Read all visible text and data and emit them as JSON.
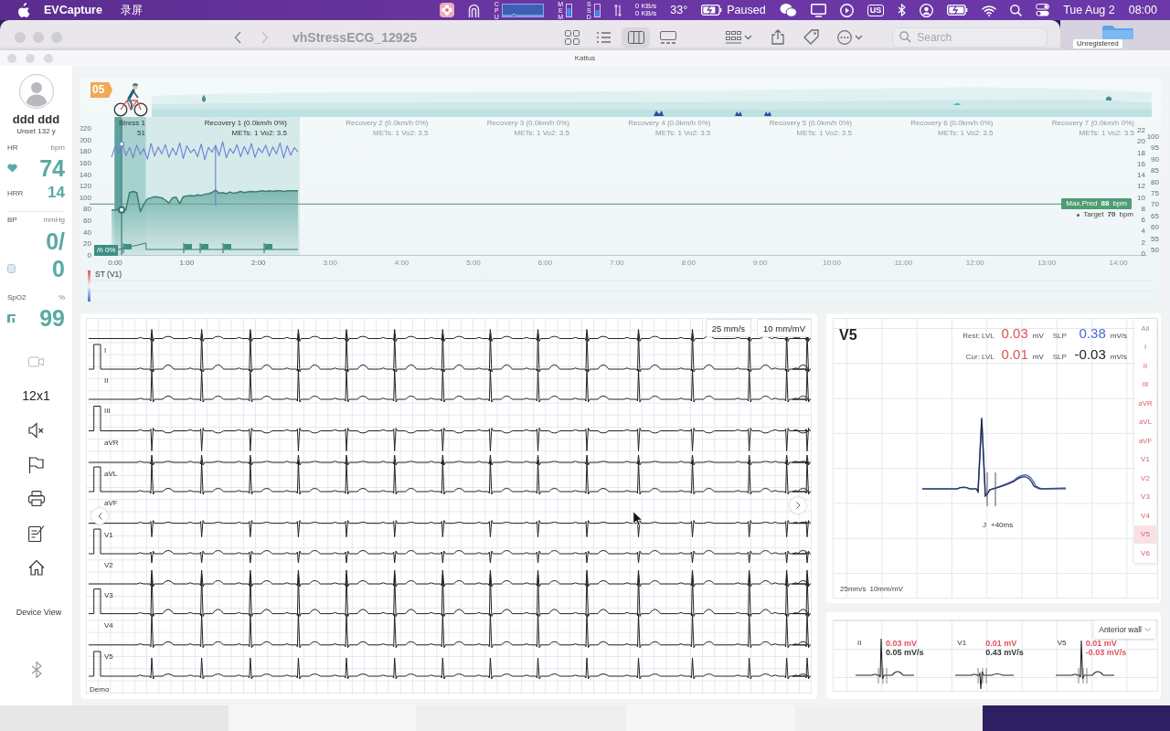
{
  "menu_bar": {
    "app_name": "EVCapture",
    "menus": [
      "录屏"
    ],
    "cpu_label": "CPU",
    "mem_label": "MEM",
    "ssd_label": "SSD",
    "upload": "0 KB/s",
    "download": "0 KB/s",
    "temperature": "33°",
    "battery_status": "Paused",
    "input_source": "US",
    "date": "Tue Aug 2",
    "time": "08:00"
  },
  "finder": {
    "title": "vhStressECG_12925",
    "view_modes": [
      {
        "kind": "icons",
        "selected": false
      },
      {
        "kind": "list",
        "selected": false
      },
      {
        "kind": "columns",
        "selected": true
      },
      {
        "kind": "gallery",
        "selected": false
      }
    ],
    "search": {
      "placeholder": "Search"
    },
    "badge": "Unregistered"
  },
  "window": {
    "title": "Kattus"
  },
  "sidebar": {
    "patient": {
      "name": "ddd ddd",
      "info": "Unset 132 y"
    },
    "vitals": [
      {
        "kind": "hr",
        "label": "HR",
        "unit": "bpm",
        "value": "74"
      },
      {
        "kind": "hrr",
        "label": "HRR",
        "value": "14"
      },
      {
        "kind": "bp",
        "label": "BP",
        "unit": "mmHg",
        "value": "0/",
        "value2": "0"
      },
      {
        "kind": "spo2",
        "label": "SpO2",
        "unit": "%",
        "value": "99"
      }
    ],
    "layout_label": "12x1",
    "device_view": "Device View"
  },
  "trend": {
    "stage_badge": "05",
    "stages": [
      {
        "name": "Stress 1",
        "detail": "51",
        "recorded": true
      },
      {
        "name": "Recovery 1 (0.0km/h 0%)",
        "detail": "METs: 1 Vo2: 3.5",
        "recorded": true
      },
      {
        "name": "Recovery 2 (0.0km/h 0%)",
        "detail": "METs: 1 Vo2: 3.5",
        "recorded": false
      },
      {
        "name": "Recovery 3 (0.0km/h 0%)",
        "detail": "METs: 1 Vo2: 3.5",
        "recorded": false
      },
      {
        "name": "Recovery 4 (0.0km/h 0%)",
        "detail": "METs: 1 Vo2: 3.5",
        "recorded": false
      },
      {
        "name": "Recovery 5 (0.0km/h 0%)",
        "detail": "METs: 1 Vo2: 3.5",
        "recorded": false
      },
      {
        "name": "Recovery 6 (0.0km/h 0%)",
        "detail": "METs: 1 Vo2: 3.5",
        "recorded": false
      },
      {
        "name": "Recovery 7 (0.0km/h 0%)",
        "detail": "METs: 1 Vo2: 3.5",
        "recorded": false
      }
    ],
    "speed_badge": "/h 0%",
    "chart_data": {
      "type": "line",
      "x": [
        -0.05,
        0,
        0.05,
        0.1,
        0.15,
        0.2,
        0.25,
        0.3,
        0.35,
        0.4,
        0.45,
        0.5,
        0.55,
        0.6,
        0.65,
        0.7,
        0.75,
        0.8,
        0.85,
        0.9,
        0.95,
        1,
        1.05,
        1.1,
        1.15,
        1.2,
        1.25,
        1.3,
        1.35,
        1.4,
        1.45,
        1.5,
        1.55,
        1.6,
        1.65,
        1.7,
        1.75,
        1.8,
        1.85,
        1.9,
        1.95,
        2,
        2.05,
        2.1,
        2.15,
        2.2,
        2.25,
        2.3,
        2.35,
        2.4,
        2.45,
        2.5,
        2.55
      ],
      "series": [
        {
          "color": "#6c7fd6",
          "values": [
            170,
            188,
            176,
            192,
            172,
            186,
            168,
            190,
            174,
            184,
            166,
            193,
            171,
            187,
            175,
            191,
            169,
            185,
            173,
            194,
            167,
            189,
            177,
            183,
            170,
            192,
            165,
            186,
            178,
            190,
            172,
            196,
            168,
            184,
            176,
            191,
            170,
            188,
            174,
            193,
            169,
            185,
            177,
            190,
            171,
            187,
            175,
            194,
            168,
            189,
            173,
            186,
            178
          ]
        },
        {
          "color": "#3f7c74",
          "values": [
            78,
            78,
            78,
            78,
            78,
            108,
            110,
            108,
            75,
            88,
            97,
            99,
            101,
            100,
            99,
            95,
            90,
            99,
            100,
            89,
            101,
            102,
            103,
            102,
            104,
            103,
            105,
            106,
            108,
            112,
            107,
            108,
            106,
            109,
            107,
            108,
            110,
            108,
            109,
            110,
            109,
            110,
            111,
            110,
            111,
            110,
            111,
            111,
            110,
            111,
            111,
            111,
            111
          ]
        }
      ],
      "xlim": [
        -0.1,
        14.4
      ],
      "ylim": [
        0,
        220
      ],
      "yticks": [
        0,
        20,
        40,
        60,
        80,
        100,
        120,
        140,
        160,
        180,
        200,
        220
      ],
      "xticks": [
        {
          "value": 0,
          "label": "0:00"
        },
        {
          "value": 1,
          "label": "1:00"
        },
        {
          "value": 2,
          "label": "2:00"
        },
        {
          "value": 3,
          "label": "3:00"
        },
        {
          "value": 4,
          "label": "4:00"
        },
        {
          "value": 5,
          "label": "5:00"
        },
        {
          "value": 6,
          "label": "6:00"
        },
        {
          "value": 7,
          "label": "7:00"
        },
        {
          "value": 8,
          "label": "8:00"
        },
        {
          "value": 9,
          "label": "9:00"
        },
        {
          "value": 10,
          "label": "10:00"
        },
        {
          "value": 11,
          "label": "11:00"
        },
        {
          "value": 12,
          "label": "12:00"
        },
        {
          "value": 13,
          "label": "13:00"
        },
        {
          "value": 14,
          "label": "14:00"
        }
      ]
    },
    "right_axis": {
      "outer": [
        "100",
        "95",
        "90",
        "85",
        "80",
        "75",
        "70",
        "65",
        "60",
        "55",
        "50"
      ],
      "inner": [
        "22",
        "20",
        "18",
        "16",
        "14",
        "12",
        "10",
        "8",
        "6",
        "4",
        "2",
        "0"
      ]
    },
    "max_pred": {
      "label": "Max.Pred",
      "value": "88",
      "unit": "bpm"
    },
    "target": {
      "label": "Target",
      "value": "70",
      "unit": "bpm"
    },
    "st_label": "ST (V1)"
  },
  "ecg_strip": {
    "leads": [
      "I",
      "II",
      "III",
      "aVR",
      "aVL",
      "aVF",
      "V1",
      "V2",
      "V3",
      "V4",
      "V5"
    ],
    "footer": "Demo",
    "speed": "25 mm/s",
    "gain": "10 mm/mV"
  },
  "st_detail": {
    "lead": "V5",
    "rows": [
      {
        "label": "Rest: LVL",
        "lvl": {
          "value": "0.03",
          "unit": "mV",
          "color": "#e0505a"
        },
        "slp": {
          "label": "SLP",
          "value": "0.38",
          "unit": "mV/s",
          "color": "#4a6bd0"
        }
      },
      {
        "label": "Cur: LVL",
        "lvl": {
          "value": "0.01",
          "unit": "mV",
          "color": "#e0505a"
        },
        "slp": {
          "label": "SLP",
          "value": "-0.03",
          "unit": "mV/s",
          "color": "#222222"
        }
      }
    ],
    "leads": [
      {
        "label": "All",
        "kind": "all",
        "selected": false
      },
      {
        "label": "I",
        "kind": "lead",
        "selected": false
      },
      {
        "label": "II",
        "kind": "lead",
        "selected": false
      },
      {
        "label": "III",
        "kind": "lead",
        "selected": false
      },
      {
        "label": "aVR",
        "kind": "lead",
        "selected": false
      },
      {
        "label": "aVL",
        "kind": "lead",
        "selected": false
      },
      {
        "label": "aVF",
        "kind": "lead",
        "selected": false
      },
      {
        "label": "V1",
        "kind": "lead",
        "selected": false
      },
      {
        "label": "V2",
        "kind": "lead",
        "selected": false
      },
      {
        "label": "V3",
        "kind": "lead",
        "selected": false
      },
      {
        "label": "V4",
        "kind": "lead",
        "selected": false
      },
      {
        "label": "V5",
        "kind": "lead",
        "selected": true
      },
      {
        "label": "V6",
        "kind": "lead",
        "selected": false
      }
    ],
    "j_label": "J",
    "j_offset": "+40ms",
    "speed": "25mm/s",
    "gain": "10mm/mV"
  },
  "st_group": {
    "region": "Anterior wall",
    "beats": [
      {
        "lead": "II",
        "lvl": {
          "value": "0.03 mV",
          "color": "#e0505a"
        },
        "slp": {
          "value": "0.05 mV/s",
          "color": "#333333"
        }
      },
      {
        "lead": "V1",
        "lvl": {
          "value": "0.01 mV",
          "color": "#e0505a"
        },
        "slp": {
          "value": "0.43 mV/s",
          "color": "#333333"
        }
      },
      {
        "lead": "V5",
        "lvl": {
          "value": "0.01 mV",
          "color": "#e0505a"
        },
        "slp": {
          "value": "-0.03 mV/s",
          "color": "#e0505a"
        }
      }
    ]
  }
}
